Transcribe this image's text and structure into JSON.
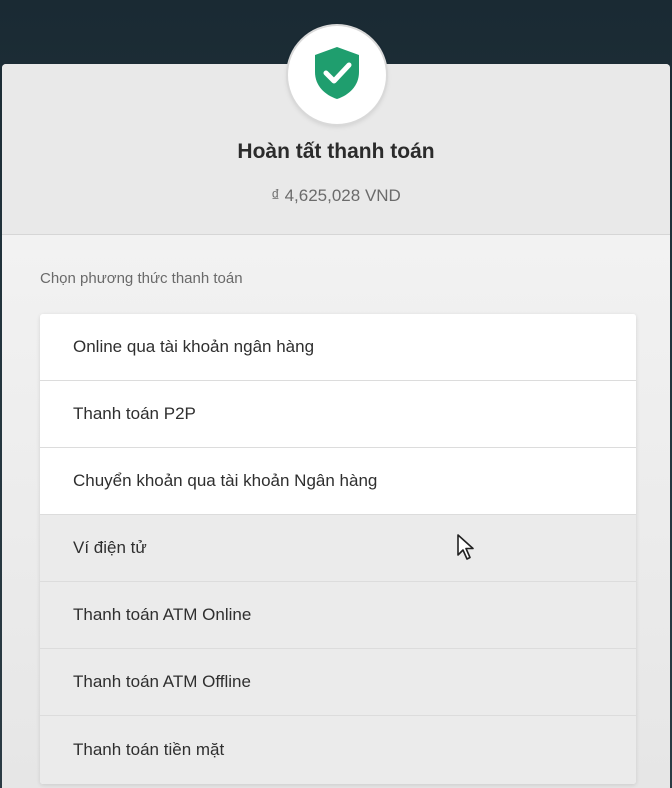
{
  "header": {
    "title": "Hoàn tất thanh toán",
    "amount": "₫ 4,625,028 VND",
    "icon": "shield-check-icon",
    "shield_color": "#1f9e6e"
  },
  "payment": {
    "section_label": "Chọn phương thức thanh toán",
    "methods": [
      {
        "label": "Online qua tài khoản ngân hàng"
      },
      {
        "label": "Thanh toán P2P"
      },
      {
        "label": "Chuyển khoản qua tài khoản Ngân hàng"
      },
      {
        "label": "Ví điện tử"
      },
      {
        "label": "Thanh toán ATM Online"
      },
      {
        "label": "Thanh toán ATM Offline"
      },
      {
        "label": "Thanh toán tiền mặt"
      }
    ]
  }
}
